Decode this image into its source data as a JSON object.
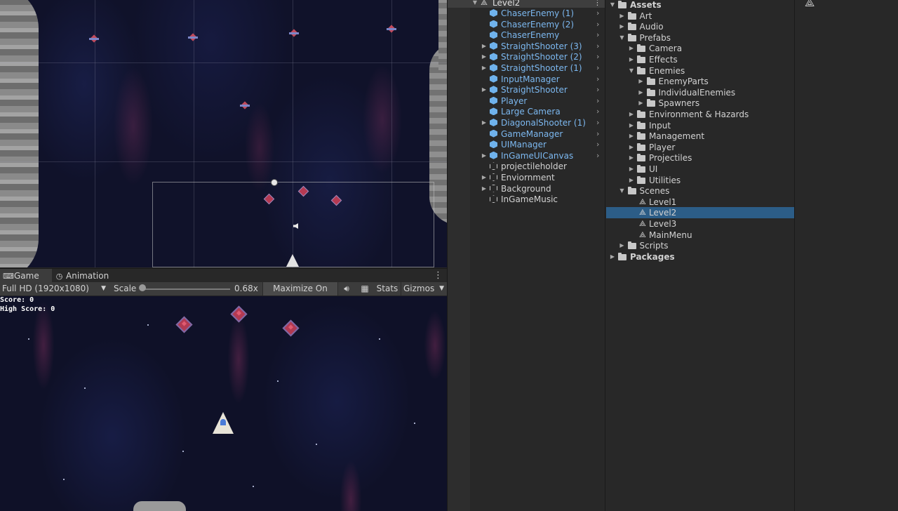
{
  "hierarchy": {
    "scene_name": "Level2",
    "items": [
      {
        "label": "ChaserEnemy (1)",
        "prefab": true,
        "expandable": false
      },
      {
        "label": "ChaserEnemy (2)",
        "prefab": true,
        "expandable": false
      },
      {
        "label": "ChaserEnemy",
        "prefab": true,
        "expandable": false
      },
      {
        "label": "StraightShooter (3)",
        "prefab": true,
        "expandable": true
      },
      {
        "label": "StraightShooter (2)",
        "prefab": true,
        "expandable": true
      },
      {
        "label": "StraightShooter (1)",
        "prefab": true,
        "expandable": true
      },
      {
        "label": "InputManager",
        "prefab": true,
        "expandable": false
      },
      {
        "label": "StraightShooter",
        "prefab": true,
        "expandable": true
      },
      {
        "label": "Player",
        "prefab": true,
        "expandable": false
      },
      {
        "label": "Large Camera",
        "prefab": true,
        "expandable": false
      },
      {
        "label": "DiagonalShooter (1)",
        "prefab": true,
        "expandable": true
      },
      {
        "label": "GameManager",
        "prefab": true,
        "expandable": false
      },
      {
        "label": "UIManager",
        "prefab": true,
        "expandable": false
      },
      {
        "label": "InGameUICanvas",
        "prefab": true,
        "expandable": true
      },
      {
        "label": "projectileholder",
        "prefab": false,
        "expandable": false
      },
      {
        "label": "Enviornment",
        "prefab": false,
        "expandable": true
      },
      {
        "label": "Background",
        "prefab": false,
        "expandable": true
      },
      {
        "label": "InGameMusic",
        "prefab": false,
        "expandable": false
      }
    ]
  },
  "project": {
    "items": [
      {
        "label": "Assets",
        "type": "folder",
        "depth": 0,
        "arrow": "expanded",
        "bold": true
      },
      {
        "label": "Art",
        "type": "folder",
        "depth": 1,
        "arrow": "collapsed"
      },
      {
        "label": "Audio",
        "type": "folder",
        "depth": 1,
        "arrow": "collapsed"
      },
      {
        "label": "Prefabs",
        "type": "folder",
        "depth": 1,
        "arrow": "expanded"
      },
      {
        "label": "Camera",
        "type": "folder",
        "depth": 2,
        "arrow": "collapsed"
      },
      {
        "label": "Effects",
        "type": "folder",
        "depth": 2,
        "arrow": "collapsed"
      },
      {
        "label": "Enemies",
        "type": "folder",
        "depth": 2,
        "arrow": "expanded"
      },
      {
        "label": "EnemyParts",
        "type": "folder",
        "depth": 3,
        "arrow": "collapsed"
      },
      {
        "label": "IndividualEnemies",
        "type": "folder",
        "depth": 3,
        "arrow": "collapsed"
      },
      {
        "label": "Spawners",
        "type": "folder",
        "depth": 3,
        "arrow": "collapsed"
      },
      {
        "label": "Environment & Hazards",
        "type": "folder",
        "depth": 2,
        "arrow": "collapsed"
      },
      {
        "label": "Input",
        "type": "folder",
        "depth": 2,
        "arrow": "collapsed"
      },
      {
        "label": "Management",
        "type": "folder",
        "depth": 2,
        "arrow": "collapsed"
      },
      {
        "label": "Player",
        "type": "folder",
        "depth": 2,
        "arrow": "collapsed"
      },
      {
        "label": "Projectiles",
        "type": "folder",
        "depth": 2,
        "arrow": "collapsed"
      },
      {
        "label": "UI",
        "type": "folder",
        "depth": 2,
        "arrow": "collapsed"
      },
      {
        "label": "Utilities",
        "type": "folder",
        "depth": 2,
        "arrow": "collapsed"
      },
      {
        "label": "Scenes",
        "type": "folder",
        "depth": 1,
        "arrow": "expanded"
      },
      {
        "label": "Level1",
        "type": "scene",
        "depth": 2,
        "arrow": "none"
      },
      {
        "label": "Level2",
        "type": "scene",
        "depth": 2,
        "arrow": "none",
        "selected": true
      },
      {
        "label": "Level3",
        "type": "scene",
        "depth": 2,
        "arrow": "none"
      },
      {
        "label": "MainMenu",
        "type": "scene",
        "depth": 2,
        "arrow": "none"
      },
      {
        "label": "Scripts",
        "type": "folder",
        "depth": 1,
        "arrow": "collapsed"
      },
      {
        "label": "Packages",
        "type": "folder",
        "depth": 0,
        "arrow": "collapsed",
        "bold": true
      }
    ]
  },
  "game_panel": {
    "tabs": {
      "game": "Game",
      "animation": "Animation"
    },
    "resolution": "Full HD (1920x1080)",
    "scale_label": "Scale",
    "scale_value": "0.68x",
    "maximize_label": "Maximize On Play",
    "stats_label": "Stats",
    "gizmos_label": "Gizmos",
    "score": "Score: 0",
    "high_score": "High Score: 0",
    "menu_icon": "⋮"
  },
  "colors": {
    "prefab_blue": "#7cb8f0",
    "selection": "#2c5d87",
    "panel_bg": "#282828",
    "toolbar_bg": "#3c3c3c"
  },
  "icons": {
    "game-tab": "gamepad-icon",
    "animation-tab": "clock-icon",
    "mute": "speaker-icon",
    "keyboard": "keyboard-icon",
    "scene_file": "unity-scene-icon",
    "prefab": "blue-cube-icon",
    "gameobject": "cube-outline-icon"
  }
}
